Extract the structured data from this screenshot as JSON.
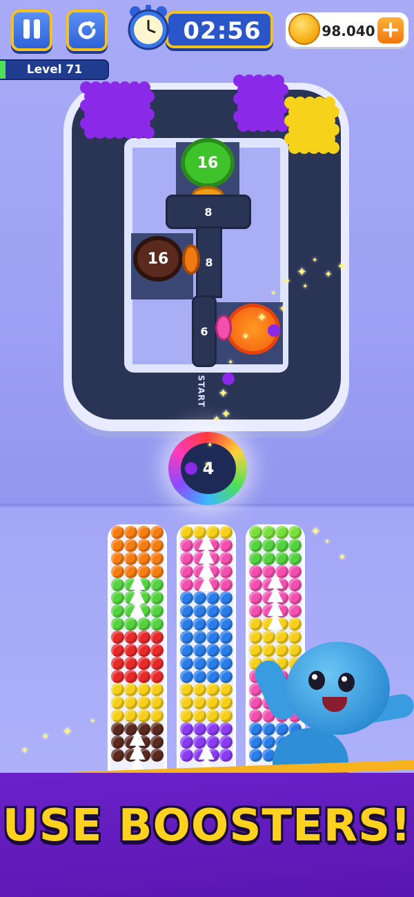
{
  "hud": {
    "timer": "02:56",
    "coins": "98.040",
    "plus_label": "+",
    "level_label": "Level 71",
    "level_progress": 0.05
  },
  "board": {
    "start_label": "START",
    "green_slot_value": "16",
    "slot_top_value": "8",
    "slot_middle_value": "8",
    "slot_left_value": "6",
    "brown_ring_value": "16",
    "portal_value": "4"
  },
  "banner": {
    "text": "USE BOOSTERS!"
  },
  "colors": {
    "orange": "#f67d12",
    "green": "#55d240",
    "red": "#e62a2a",
    "yellow": "#f5cf1a",
    "brown": "#5a2a1f",
    "pink": "#f24fae",
    "blue": "#2a7de8",
    "purple": "#8a3cf0",
    "lime": "#7adf3a",
    "crowd_purple": "#8a2ae8",
    "crowd_yellow": "#f7d21a"
  }
}
